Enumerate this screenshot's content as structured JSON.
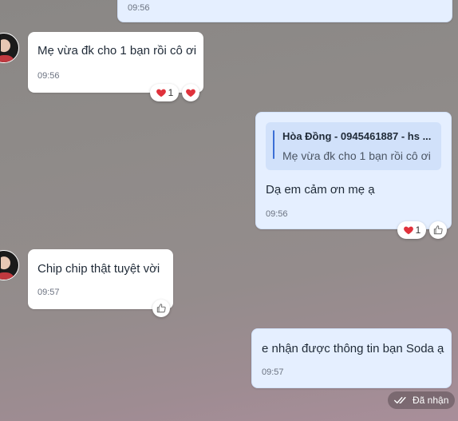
{
  "messages": [
    {
      "text": "",
      "time": "09:56"
    },
    {
      "text": "Mẹ vừa đk cho 1 bạn rồi cô ơi",
      "time": "09:56",
      "reaction_count": "1"
    },
    {
      "quote_title": "Hòa Đồng - 0945461887 - hs ...",
      "quote_text": "Mẹ vừa đk cho 1 bạn rồi cô ơi",
      "text": "Dạ em cảm ơn mẹ ạ",
      "time": "09:56",
      "reaction_count": "1"
    },
    {
      "text": "Chip chip thật tuyệt vời",
      "time": "09:57"
    },
    {
      "text": "e nhận được thông tin bạn Soda ạ",
      "time": "09:57"
    }
  ],
  "status": {
    "label": "Đã nhận"
  },
  "colors": {
    "heart": "#e0323c",
    "sent_bubble": "#e5efff",
    "quote_bar": "#3b6fd6"
  },
  "icons": [
    "heart-icon",
    "like-icon",
    "double-check-icon",
    "avatar"
  ]
}
